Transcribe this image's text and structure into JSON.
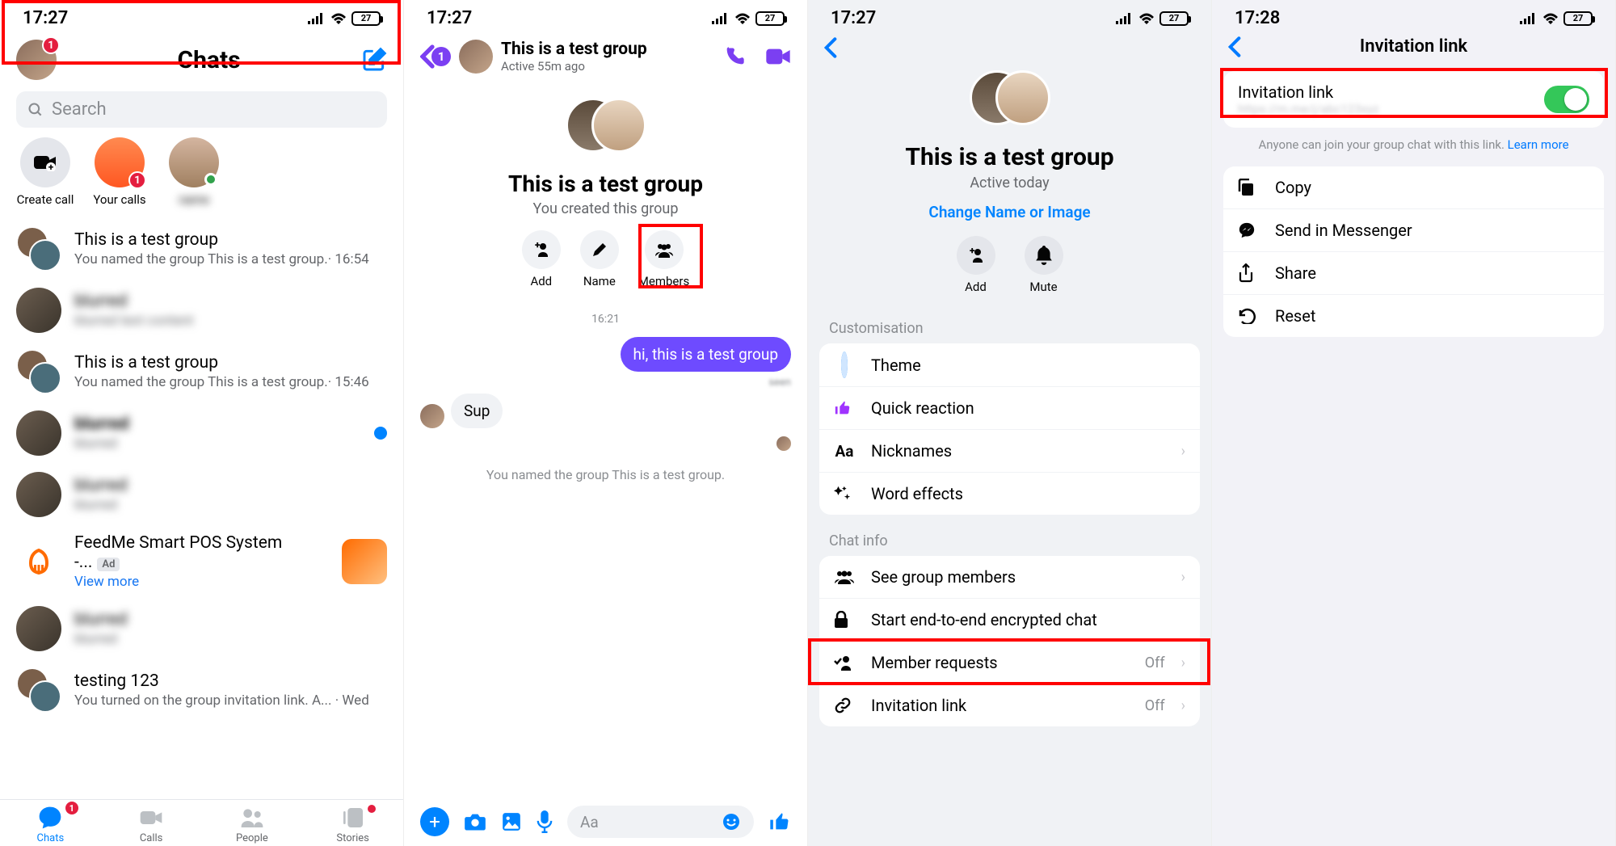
{
  "status": {
    "time1": "17:27",
    "time2": "17:27",
    "time3": "17:27",
    "time4": "17:28",
    "battery": "27"
  },
  "s1": {
    "title": "Chats",
    "badge": "1",
    "search_placeholder": "Search",
    "stories": [
      {
        "label": "Create call"
      },
      {
        "label": "Your calls",
        "badge": "1"
      },
      {
        "label": ""
      }
    ],
    "chats": [
      {
        "name": "This is a test group",
        "sub": "You named the group This is a test group.· 16:54",
        "hot": true
      },
      {
        "name": "blurred",
        "sub": "blurred text content",
        "blur": true
      },
      {
        "name": "This is a test group",
        "sub": "You named the group This is a test group.· 15:46"
      },
      {
        "name": "blurred",
        "sub": "blurred",
        "blur": true,
        "unread": true
      },
      {
        "name": "blurred",
        "sub": "blurred",
        "blur": true
      },
      {
        "name": "FeedMe Smart POS System -...",
        "sub": "View more",
        "ad": true
      },
      {
        "name": "blurred",
        "sub": "blurred",
        "blur": true
      },
      {
        "name": "testing 123",
        "sub": "You turned on the group invitation link. A... · Wed"
      }
    ],
    "tabs": [
      {
        "label": "Chats",
        "badge": "1",
        "active": true
      },
      {
        "label": "Calls"
      },
      {
        "label": "People"
      },
      {
        "label": "Stories",
        "dot": true
      }
    ]
  },
  "s2": {
    "back_badge": "1",
    "header_title": "This is a test group",
    "header_sub": "Active 55m ago",
    "hero_title": "This is a test group",
    "hero_sub": "You created this group",
    "actions": [
      {
        "label": "Add"
      },
      {
        "label": "Name"
      },
      {
        "label": "Members",
        "hot": true
      }
    ],
    "time": "16:21",
    "msg_out": "hi, this is a test group",
    "msg_in": "Sup",
    "sys": "You named the group This is a test group.",
    "input_placeholder": "Aa"
  },
  "s3": {
    "hero_title": "This is a test group",
    "hero_sub": "Active today",
    "change": "Change Name or Image",
    "actions": [
      {
        "label": "Add"
      },
      {
        "label": "Mute"
      }
    ],
    "sec1": "Customisation",
    "rows1": [
      {
        "label": "Theme",
        "icon": "theme"
      },
      {
        "label": "Quick reaction",
        "icon": "like"
      },
      {
        "label": "Nicknames",
        "icon": "Aa",
        "chev": true
      },
      {
        "label": "Word effects",
        "icon": "fx"
      }
    ],
    "sec2": "Chat info",
    "rows2": [
      {
        "label": "See group members",
        "icon": "group",
        "chev": true
      },
      {
        "label": "Start end-to-end encrypted chat",
        "icon": "lock"
      },
      {
        "label": "Member requests",
        "icon": "req",
        "val": "Off",
        "chev": true,
        "hot": true
      },
      {
        "label": "Invitation link",
        "icon": "link",
        "val": "Off",
        "chev": true
      }
    ]
  },
  "s4": {
    "title": "Invitation link",
    "card_title": "Invitation link",
    "helper": "Anyone can join your group chat with this link. ",
    "learn": "Learn more",
    "rows": [
      {
        "label": "Copy",
        "icon": "copy"
      },
      {
        "label": "Send in Messenger",
        "icon": "msgr"
      },
      {
        "label": "Share",
        "icon": "share"
      },
      {
        "label": "Reset",
        "icon": "reset"
      }
    ]
  }
}
